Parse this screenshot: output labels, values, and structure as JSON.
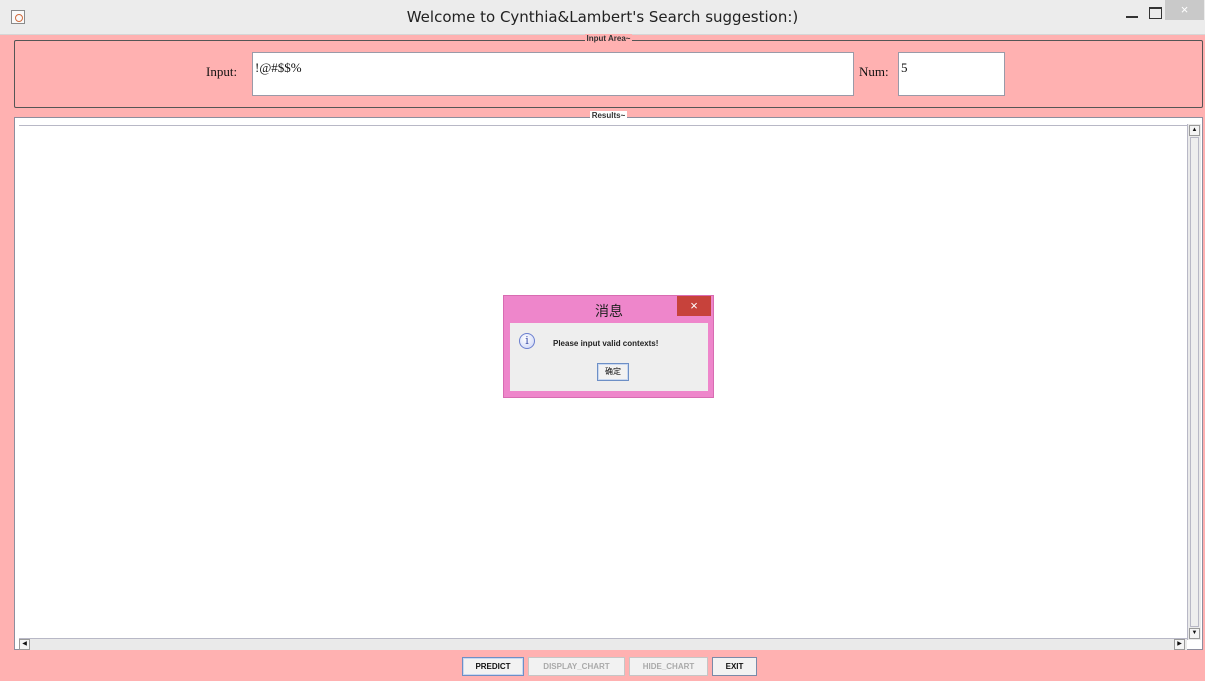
{
  "window": {
    "title": "Welcome to Cynthia&Lambert's Search suggestion:)",
    "app_icon": "java-cup-icon",
    "controls": {
      "minimize_glyph": "–",
      "close_glyph": "×"
    }
  },
  "input_area": {
    "legend": "Input Area~",
    "input_label": "Input:",
    "input_value": "!@#$$%",
    "num_label": "Num:",
    "num_value": "5"
  },
  "results": {
    "legend": "Results~",
    "content": ""
  },
  "buttons": [
    {
      "label": "PREDICT",
      "enabled": true
    },
    {
      "label": "DISPLAY_CHART",
      "enabled": false
    },
    {
      "label": "HIDE_CHART",
      "enabled": false
    },
    {
      "label": "EXIT",
      "enabled": true
    }
  ],
  "dialog": {
    "title": "消息",
    "close_glyph": "×",
    "icon": "info-icon",
    "message": "Please input valid contexts!",
    "ok_label": "确定"
  },
  "colors": {
    "panel_pink": "#ffb1b1",
    "dialog_frame": "#ee86cb",
    "dialog_close": "#c7423b"
  }
}
